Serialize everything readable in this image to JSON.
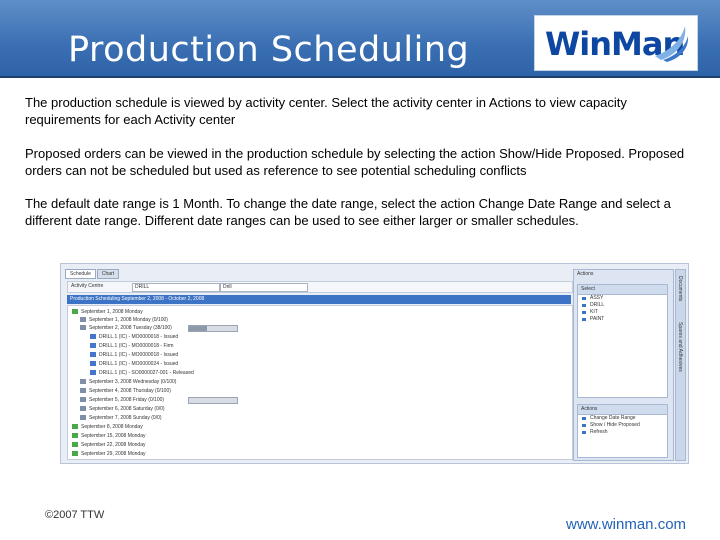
{
  "slide": {
    "title": "Production Scheduling",
    "logo_text": "WinMan",
    "paragraphs": [
      "The production schedule is viewed by activity center.  Select the activity center in Actions to view capacity requirements for each Activity center",
      "Proposed orders can be viewed in the production schedule by selecting the action Show/Hide Proposed.  Proposed orders can not be scheduled but used as reference to see potential scheduling conflicts",
      "The default date range is 1 Month.  To change the date range, select the action Change Date Range and select a different date range.  Different date ranges can be used to see either larger or smaller schedules."
    ],
    "copyright": "©2007 TTW",
    "url": "www.winman.com"
  },
  "screenshot": {
    "tabs": [
      "Schedule",
      "Chart"
    ],
    "filter_label": "Activity Centre",
    "filter_from": "DRILL",
    "filter_to": "Drill",
    "header_bar": "Production Scheduling    September 2, 2008 - October 2, 2008",
    "rows": [
      "September 1, 2008 Monday",
      "September 1, 2008 Monday (0/100)",
      "September 2, 2008 Tuesday (38/100)",
      "DRILL.1 (IC) - MO0000018 - Issued",
      "DRILL.1 (IC) - MO0000018 - Firm",
      "DRILL.1 (IC) - MO0000018 - Issued",
      "DRILL.1 (IC) - MO0000024 - Issued",
      "DRILL.1 (IC) - SO0000027-001 - Released",
      "September 3, 2008 Wednesday (0/100)",
      "September 4, 2008 Thursday (0/100)",
      "September 5, 2008 Friday (0/100)",
      "September 6, 2008 Saturday (0/0)",
      "September 7, 2008 Sunday (0/0)",
      "September 8, 2008 Monday",
      "September 15, 2008 Monday",
      "September 22, 2008 Monday",
      "September 29, 2008 Monday"
    ],
    "capacity_fill": 0.38,
    "actions_title": "Actions",
    "select_panel_title": "Select",
    "select_items": [
      "ASSY",
      "DRILL",
      "KIT",
      "PAINT"
    ],
    "actions_panel_title": "Actions",
    "action_items": [
      "Change Date Range",
      "Show / Hide Proposed",
      "Refresh"
    ],
    "side_tabs": [
      "Documents",
      "Spares and Adhesives"
    ]
  },
  "colors": {
    "header": "#3a6fb3",
    "url": "#2462b7",
    "logo_text": "#0d47a1"
  }
}
